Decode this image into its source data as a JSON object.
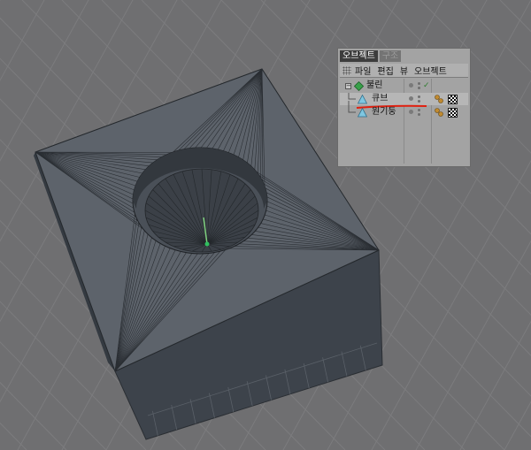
{
  "panel": {
    "tabs": [
      {
        "label": "오브젝트",
        "active": true
      },
      {
        "label": "구조",
        "active": false
      }
    ],
    "menu": [
      "파일",
      "편집",
      "뷰",
      "오브젝트"
    ],
    "tree": [
      {
        "label": "불린",
        "icon": "boolean-icon",
        "level": 0
      },
      {
        "label": "큐브",
        "icon": "cube-primitive-icon",
        "level": 1,
        "selected": true
      },
      {
        "label": "원기둥",
        "icon": "cylinder-primitive-icon",
        "level": 1
      }
    ]
  },
  "colors": {
    "background": "#6f6f71",
    "grid_line": "#7c7c7e",
    "model_top": "#5f656d",
    "model_side": "#3e444c",
    "highlight_underline": "#e02010",
    "axis_y": "#7fd07f"
  }
}
